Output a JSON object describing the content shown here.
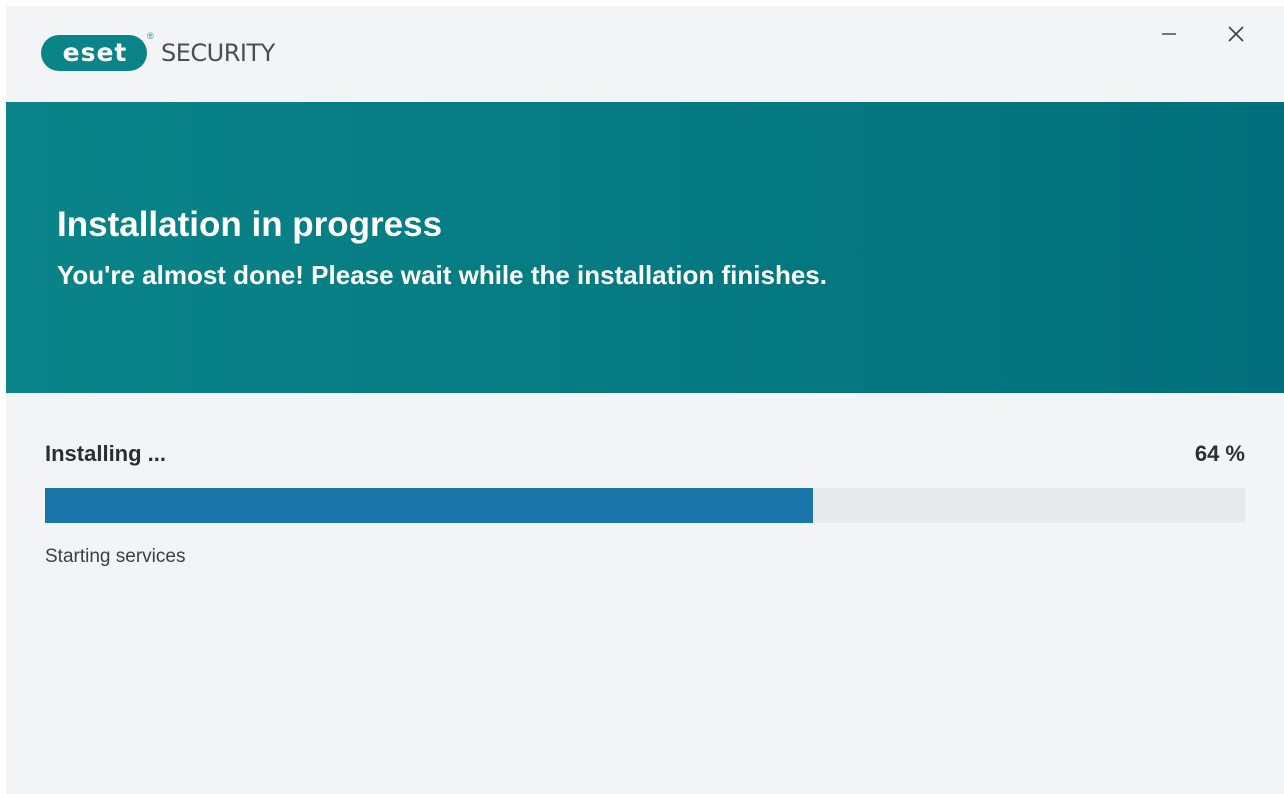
{
  "brand": {
    "logo_text": "eset",
    "product_name": "SECURITY",
    "accent_color": "#0a8488"
  },
  "window_controls": {
    "minimize_icon": "minimize-icon",
    "close_icon": "close-icon"
  },
  "banner": {
    "title": "Installation in progress",
    "subtitle": "You're almost done! Please wait while the installation finishes.",
    "background_color": "#057a82"
  },
  "progress": {
    "status": "Installing ...",
    "percent_text": "64 %",
    "percent_value": 64,
    "detail": "Starting services",
    "bar_color": "#1a76a8"
  }
}
